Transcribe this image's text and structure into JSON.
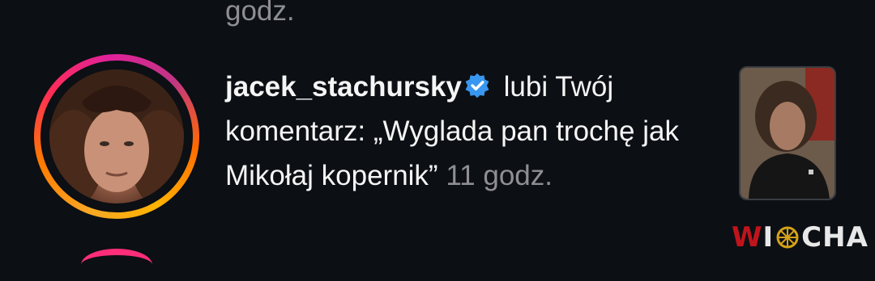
{
  "previous_item": {
    "time_suffix": "godz."
  },
  "notification": {
    "username": "jacek_stachursky",
    "verified_icon": "verified-badge-icon",
    "action_text": " lubi Twój komentarz: „Wyglada pan trochę jak Mikołaj kopernik” ",
    "time": "11 godz.",
    "avatar": "profile-avatar-with-story-ring",
    "thumbnail": "post-thumbnail"
  },
  "watermark": {
    "text_w": "W",
    "text_i": "I",
    "text_rest": "CHA"
  },
  "colors": {
    "background": "#0c0f14",
    "text": "#f5f5f5",
    "muted": "#8e8e93",
    "verified": "#3897f0",
    "watermark_red": "#c0141c"
  }
}
